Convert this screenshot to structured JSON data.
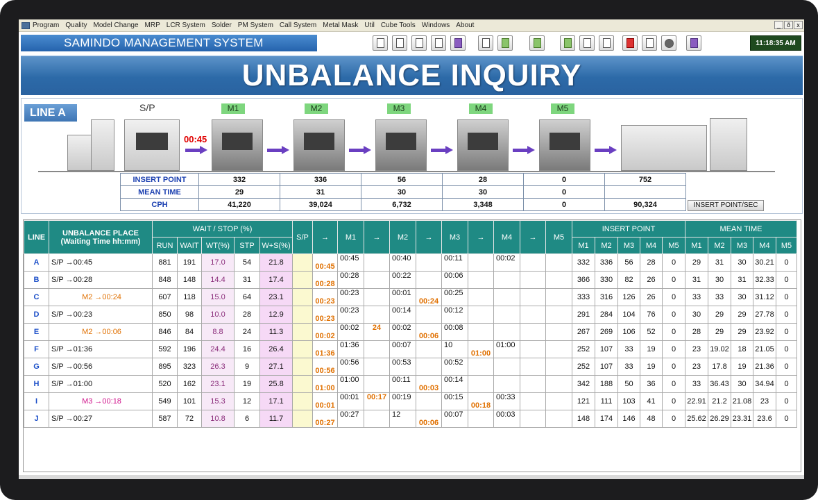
{
  "menu": [
    "Program",
    "Quality",
    "Model Change",
    "MRP",
    "LCR System",
    "Solder",
    "PM System",
    "Call System",
    "Metal Mask",
    "Util",
    "Cube Tools",
    "Windows",
    "About"
  ],
  "window_buttons": [
    "_",
    "ð",
    "x"
  ],
  "system_name": "SAMINDO MANAGEMENT SYSTEM",
  "clock": "11:18:35 AM",
  "page_title": "UNBALANCE INQUIRY",
  "line": {
    "tag": "LINE A",
    "sp_label": "S/P",
    "machines": [
      "M1",
      "M2",
      "M3",
      "M4",
      "M5"
    ],
    "wait_time": "00:45",
    "summary": {
      "insert_point_label": "INSERT POINT",
      "mean_time_label": "MEAN TIME",
      "cph_label": "CPH",
      "insert_point": [
        "332",
        "336",
        "56",
        "28",
        "0",
        "752"
      ],
      "mean_time": [
        "29",
        "31",
        "30",
        "30",
        "0",
        ""
      ],
      "cph": [
        "41,220",
        "39,024",
        "6,732",
        "3,348",
        "0",
        "90,324"
      ]
    },
    "button": "INSERT POINT/SEC"
  },
  "grid": {
    "headers": {
      "line": "LINE",
      "place1": "UNBALANCE  PLACE",
      "place2": "(Waiting Time hh:mm)",
      "wait_stop": "WAIT / STOP (%)",
      "run": "RUN",
      "wait": "WAIT",
      "wt": "WT(%)",
      "stp": "STP",
      "ws": "W+S(%)",
      "sp": "S/P",
      "arrow": "→",
      "m1": "M1",
      "m2": "M2",
      "m3": "M3",
      "m4": "M4",
      "m5": "M5",
      "insert_point": "INSERT POINT",
      "mean_time": "MEAN TIME"
    },
    "rows": [
      {
        "line": "A",
        "place": "S/P →00:45",
        "ptype": "",
        "run": "881",
        "wait": "191",
        "wt": "17.0",
        "stp": "54",
        "ws": "21.8",
        "o0": "00:45",
        "m1": "00:45",
        "o1": "",
        "m2": "00:40",
        "o2": "",
        "m3": "00:11",
        "o3": "",
        "m4": "00:02",
        "o4": "",
        "m5": "",
        "ip": [
          "332",
          "336",
          "56",
          "28",
          "0"
        ],
        "mt": [
          "29",
          "31",
          "30",
          "30.21",
          "0"
        ]
      },
      {
        "line": "B",
        "place": "S/P →00:28",
        "ptype": "",
        "run": "848",
        "wait": "148",
        "wt": "14.4",
        "stp": "31",
        "ws": "17.4",
        "o0": "00:28",
        "m1": "00:28",
        "o1": "",
        "m2": "00:22",
        "o2": "",
        "m3": "00:06",
        "o3": "",
        "m4": "",
        "o4": "",
        "m5": "",
        "ip": [
          "366",
          "330",
          "82",
          "26",
          "0"
        ],
        "mt": [
          "31",
          "30",
          "31",
          "32.33",
          "0"
        ]
      },
      {
        "line": "C",
        "place": "M2 →00:24",
        "ptype": "orange",
        "run": "607",
        "wait": "118",
        "wt": "15.0",
        "stp": "64",
        "ws": "23.1",
        "o0": "00:23",
        "m1": "00:23",
        "o1": "",
        "m2": "00:01",
        "o2": "00:24",
        "m3": "00:25",
        "o3": "",
        "m4": "",
        "o4": "",
        "m5": "",
        "ip": [
          "333",
          "316",
          "126",
          "26",
          "0"
        ],
        "mt": [
          "33",
          "33",
          "30",
          "31.12",
          "0"
        ]
      },
      {
        "line": "D",
        "place": "S/P →00:23",
        "ptype": "",
        "run": "850",
        "wait": "98",
        "wt": "10.0",
        "stp": "28",
        "ws": "12.9",
        "o0": "00:23",
        "m1": "00:23",
        "o1": "",
        "m2": "00:14",
        "o2": "",
        "m3": "00:12",
        "o3": "",
        "m4": "",
        "o4": "",
        "m5": "",
        "ip": [
          "291",
          "284",
          "104",
          "76",
          "0"
        ],
        "mt": [
          "30",
          "29",
          "29",
          "27.78",
          "0"
        ]
      },
      {
        "line": "E",
        "place": "M2 →00:06",
        "ptype": "orange",
        "run": "846",
        "wait": "84",
        "wt": "8.8",
        "stp": "24",
        "ws": "11.3",
        "o0": "00:02",
        "m1": "00:02",
        "o1": "24",
        "m2": "00:02",
        "o2": "00:06",
        "m3": "00:08",
        "o3": "",
        "m4": "",
        "o4": "",
        "m5": "",
        "ip": [
          "267",
          "269",
          "106",
          "52",
          "0"
        ],
        "mt": [
          "28",
          "29",
          "29",
          "23.92",
          "0"
        ]
      },
      {
        "line": "F",
        "place": "S/P →01:36",
        "ptype": "",
        "run": "592",
        "wait": "196",
        "wt": "24.4",
        "stp": "16",
        "ws": "26.4",
        "o0": "01:36",
        "m1": "01:36",
        "o1": "",
        "m2": "00:07",
        "o2": "",
        "m3": "10",
        "o3": "01:00",
        "m4": "01:00",
        "o4": "",
        "m5": "",
        "ip": [
          "252",
          "107",
          "33",
          "19",
          "0"
        ],
        "mt": [
          "23",
          "19.02",
          "18",
          "21.05",
          "0"
        ]
      },
      {
        "line": "G",
        "place": "S/P →00:56",
        "ptype": "",
        "run": "895",
        "wait": "323",
        "wt": "26.3",
        "stp": "9",
        "ws": "27.1",
        "o0": "00:56",
        "m1": "00:56",
        "o1": "",
        "m2": "00:53",
        "o2": "",
        "m3": "00:52",
        "o3": "",
        "m4": "",
        "o4": "",
        "m5": "",
        "ip": [
          "252",
          "107",
          "33",
          "19",
          "0"
        ],
        "mt": [
          "23",
          "17.8",
          "19",
          "21.36",
          "0"
        ]
      },
      {
        "line": "H",
        "place": "S/P →01:00",
        "ptype": "",
        "run": "520",
        "wait": "162",
        "wt": "23.1",
        "stp": "19",
        "ws": "25.8",
        "o0": "01:00",
        "m1": "01:00",
        "o1": "",
        "m2": "00:11",
        "o2": "00:03",
        "m3": "00:14",
        "o3": "",
        "m4": "",
        "o4": "",
        "m5": "",
        "ip": [
          "342",
          "188",
          "50",
          "36",
          "0"
        ],
        "mt": [
          "33",
          "36.43",
          "30",
          "34.94",
          "0"
        ]
      },
      {
        "line": "I",
        "place": "M3 →00:18",
        "ptype": "magenta",
        "run": "549",
        "wait": "101",
        "wt": "15.3",
        "stp": "12",
        "ws": "17.1",
        "o0": "00:01",
        "m1": "00:01",
        "o1": "00:17",
        "m2": "00:19",
        "o2": "",
        "m3": "00:15",
        "o3": "00:18",
        "m4": "00:33",
        "o4": "",
        "m5": "",
        "ip": [
          "121",
          "111",
          "103",
          "41",
          "0"
        ],
        "mt": [
          "22.91",
          "21.2",
          "21.08",
          "23",
          "0"
        ]
      },
      {
        "line": "J",
        "place": "S/P →00:27",
        "ptype": "",
        "run": "587",
        "wait": "72",
        "wt": "10.8",
        "stp": "6",
        "ws": "11.7",
        "o0": "00:27",
        "m1": "00:27",
        "o1": "",
        "m2": "12",
        "o2": "00:06",
        "m3": "00:07",
        "o3": "",
        "m4": "00:03",
        "o4": "",
        "m5": "",
        "ip": [
          "148",
          "174",
          "146",
          "48",
          "0"
        ],
        "mt": [
          "25.62",
          "26.29",
          "23.31",
          "23.6",
          "0"
        ]
      }
    ]
  }
}
